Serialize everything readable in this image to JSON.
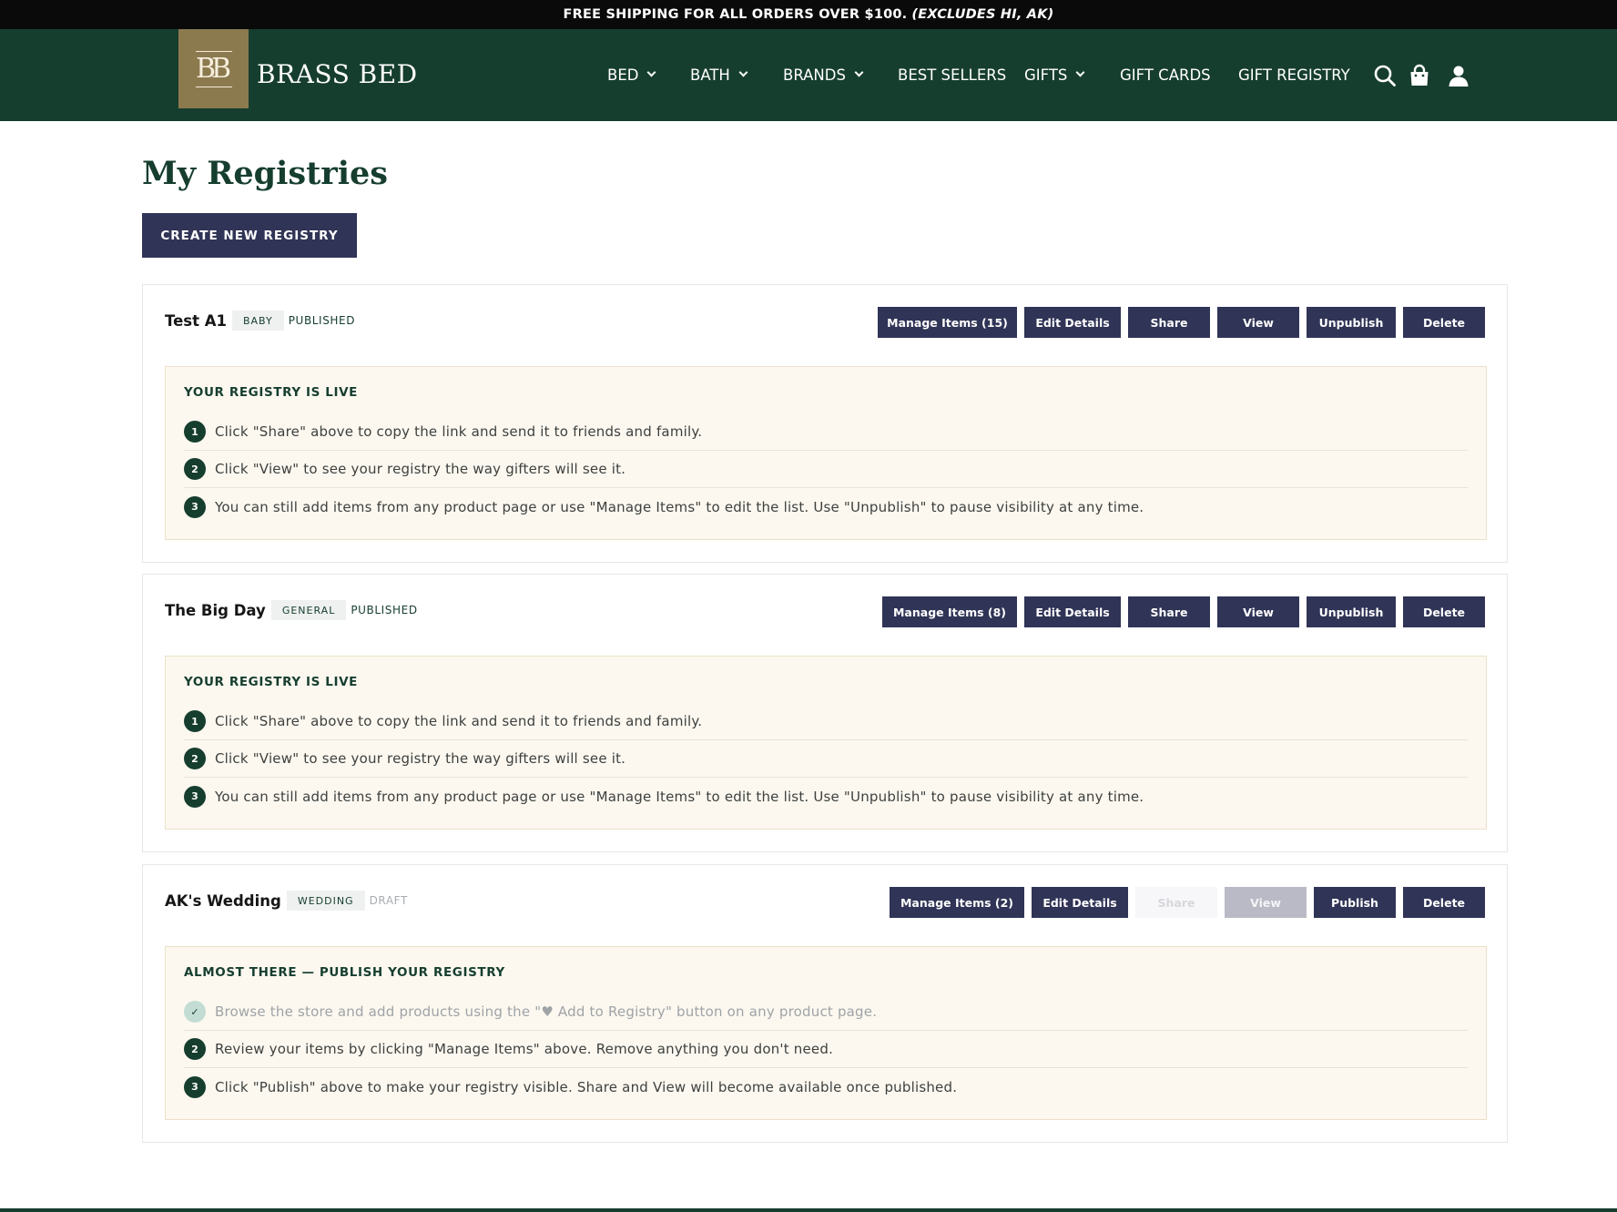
{
  "announcement": {
    "text": "FREE SHIPPING FOR ALL ORDERS OVER $100.",
    "emphasis": "(EXCLUDES HI, AK)"
  },
  "brand": {
    "monogram": "BB",
    "name": "BRASS BED"
  },
  "nav": {
    "items": [
      {
        "label": "BED",
        "dropdown": true
      },
      {
        "label": "BATH",
        "dropdown": true
      },
      {
        "label": "BRANDS",
        "dropdown": true
      },
      {
        "label": "BEST SELLERS",
        "dropdown": false
      },
      {
        "label": "GIFTS",
        "dropdown": true
      },
      {
        "label": "GIFT CARDS",
        "dropdown": false
      },
      {
        "label": "GIFT REGISTRY",
        "dropdown": false
      }
    ],
    "icons": [
      "search-icon",
      "shopping-bag-icon",
      "account-icon"
    ]
  },
  "page": {
    "title": "My Registries",
    "create_button": "CREATE NEW REGISTRY"
  },
  "registries": [
    {
      "name": "Test A1",
      "type": "BABY",
      "status": "PUBLISHED",
      "actions": {
        "manage": "Manage Items (15)",
        "edit": "Edit Details",
        "share": "Share",
        "view": "View",
        "toggle": "Unpublish",
        "delete": "Delete"
      },
      "panel_title": "YOUR REGISTRY IS LIVE",
      "steps": [
        {
          "marker": "1",
          "text": "Click \"Share\" above to copy the link and send it to friends and family."
        },
        {
          "marker": "2",
          "text": "Click \"View\" to see your registry the way gifters will see it."
        },
        {
          "marker": "3",
          "text": "You can still add items from any product page or use \"Manage Items\" to edit the list. Use \"Unpublish\" to pause visibility at any time."
        }
      ]
    },
    {
      "name": "The Big Day",
      "type": "GENERAL",
      "status": "PUBLISHED",
      "actions": {
        "manage": "Manage Items (8)",
        "edit": "Edit Details",
        "share": "Share",
        "view": "View",
        "toggle": "Unpublish",
        "delete": "Delete"
      },
      "panel_title": "YOUR REGISTRY IS LIVE",
      "steps": [
        {
          "marker": "1",
          "text": "Click \"Share\" above to copy the link and send it to friends and family."
        },
        {
          "marker": "2",
          "text": "Click \"View\" to see your registry the way gifters will see it."
        },
        {
          "marker": "3",
          "text": "You can still add items from any product page or use \"Manage Items\" to edit the list. Use \"Unpublish\" to pause visibility at any time."
        }
      ]
    },
    {
      "name": "AK's Wedding",
      "type": "WEDDING",
      "status": "DRAFT",
      "actions": {
        "manage": "Manage Items (2)",
        "edit": "Edit Details",
        "share": "Share",
        "view": "View",
        "toggle": "Publish",
        "delete": "Delete"
      },
      "panel_title": "ALMOST THERE — PUBLISH YOUR REGISTRY",
      "steps": [
        {
          "marker": "✓",
          "text": "Browse the store and add products using the \"♥ Add to Registry\" button on any product page.",
          "done": true
        },
        {
          "marker": "2",
          "text": "Review your items by clicking \"Manage Items\" above. Remove anything you don't need."
        },
        {
          "marker": "3",
          "text": "Click \"Publish\" above to make your registry visible. Share and View will become available once published."
        }
      ]
    }
  ],
  "colors": {
    "header_green": "#163e2f",
    "button_navy": "#303456",
    "logo_gold": "#8c7a4f",
    "panel_cream": "#fcf8f0"
  }
}
